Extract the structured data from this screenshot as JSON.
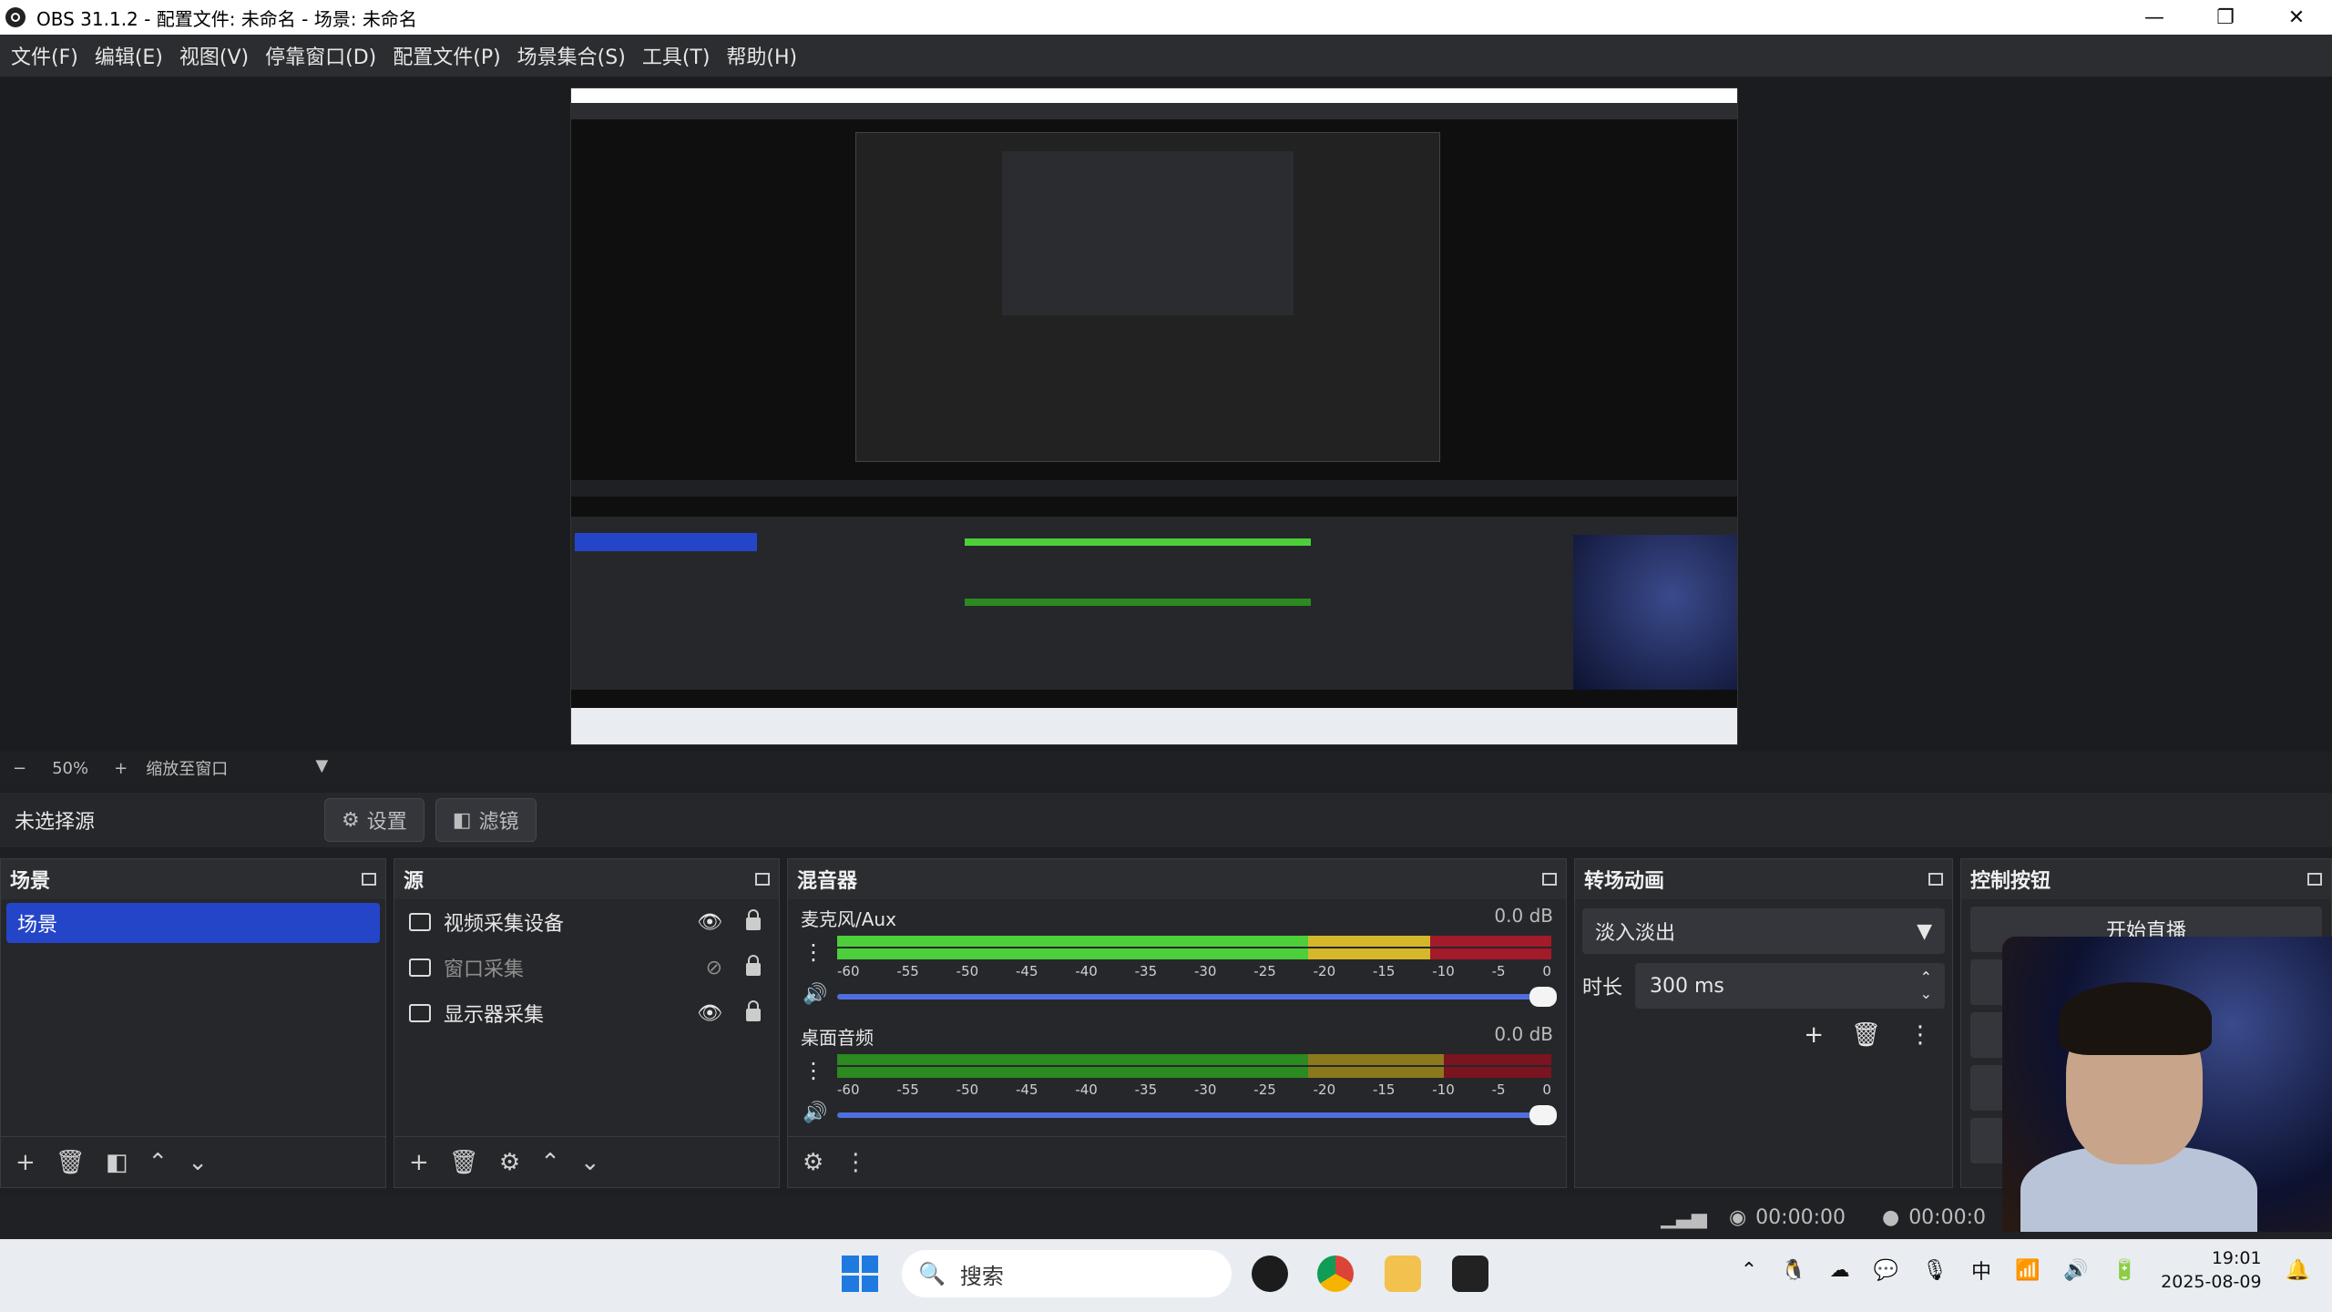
{
  "window": {
    "title": "OBS 31.1.2 - 配置文件: 未命名 - 场景: 未命名"
  },
  "window_controls": {
    "minimize": "—",
    "maximize": "❐",
    "close": "✕"
  },
  "menu": [
    "文件(F)",
    "编辑(E)",
    "视图(V)",
    "停靠窗口(D)",
    "配置文件(P)",
    "场景集合(S)",
    "工具(T)",
    "帮助(H)"
  ],
  "zoom": {
    "minus": "−",
    "value": "50%",
    "plus": "+",
    "mode": "缩放至窗口"
  },
  "source_bar": {
    "no_source": "未选择源",
    "settings": "设置",
    "filters": "滤镜"
  },
  "scenes": {
    "title": "场景",
    "items": [
      "场景"
    ]
  },
  "sources": {
    "title": "源",
    "items": [
      {
        "name": "视频采集设备",
        "visible": true,
        "icon": "camera-icon"
      },
      {
        "name": "窗口采集",
        "visible": false,
        "icon": "window-icon"
      },
      {
        "name": "显示器采集",
        "visible": true,
        "icon": "monitor-icon"
      }
    ]
  },
  "mixer": {
    "title": "混音器",
    "ticks": [
      "-60",
      "-55",
      "-50",
      "-45",
      "-40",
      "-35",
      "-30",
      "-25",
      "-20",
      "-15",
      "-10",
      "-5",
      "0"
    ],
    "channels": [
      {
        "name": "麦克风/Aux",
        "db": "0.0 dB",
        "volume": 1.0
      },
      {
        "name": "桌面音频",
        "db": "0.0 dB",
        "volume": 1.0
      }
    ]
  },
  "transitions": {
    "title": "转场动画",
    "selected": "淡入淡出",
    "duration_label": "时长",
    "duration": "300 ms"
  },
  "controls": {
    "title": "控制按钮",
    "start_stream": "开始直播"
  },
  "status": {
    "stream_time": "00:00:00",
    "record_time": "00:00:0"
  },
  "taskbar": {
    "search": "搜索",
    "time": "19:01",
    "date": "2025-08-09"
  },
  "colors": {
    "accent": "#2545c9",
    "meter_green": "#4ccf3a",
    "meter_yellow": "#d4b82a",
    "meter_red": "#a31a2a"
  }
}
